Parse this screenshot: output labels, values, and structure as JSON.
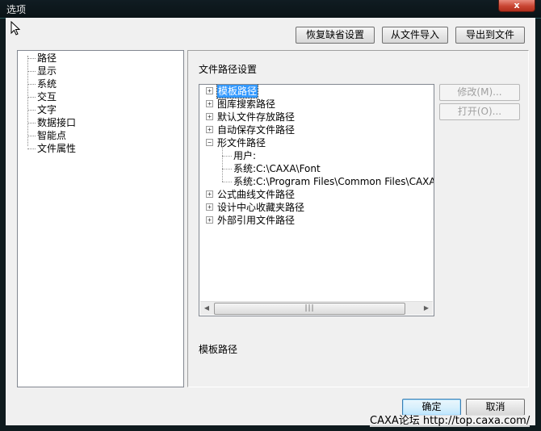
{
  "window": {
    "title": "选项",
    "close_label": "x"
  },
  "toolbar": {
    "restore_defaults": "恢复缺省设置",
    "import_from_file": "从文件导入",
    "export_to_file": "导出到文件"
  },
  "nav": {
    "items": [
      "路径",
      "显示",
      "系统",
      "交互",
      "文字",
      "数据接口",
      "智能点",
      "文件属性"
    ]
  },
  "main": {
    "section_title": "文件路径设置",
    "tree": {
      "items": [
        {
          "label": "模板路径",
          "expanded": false,
          "selected": true
        },
        {
          "label": "图库搜索路径",
          "expanded": false
        },
        {
          "label": "默认文件存放路径",
          "expanded": false
        },
        {
          "label": "自动保存文件路径",
          "expanded": false
        },
        {
          "label": "形文件路径",
          "expanded": true,
          "children": [
            "用户:",
            "系统:C:\\CAXA\\Font",
            "系统:C:\\Program Files\\Common Files\\CAXA Shared\\"
          ]
        },
        {
          "label": "公式曲线文件路径",
          "expanded": false
        },
        {
          "label": "设计中心收藏夹路径",
          "expanded": false
        },
        {
          "label": "外部引用文件路径",
          "expanded": false
        }
      ]
    },
    "modify_button": "修改(M)...",
    "open_button": "打开(O)...",
    "selected_path_label": "模板路径"
  },
  "footer": {
    "ok": "确定",
    "cancel": "取消"
  },
  "watermark": "CAXA论坛 http://top.caxa.com/"
}
